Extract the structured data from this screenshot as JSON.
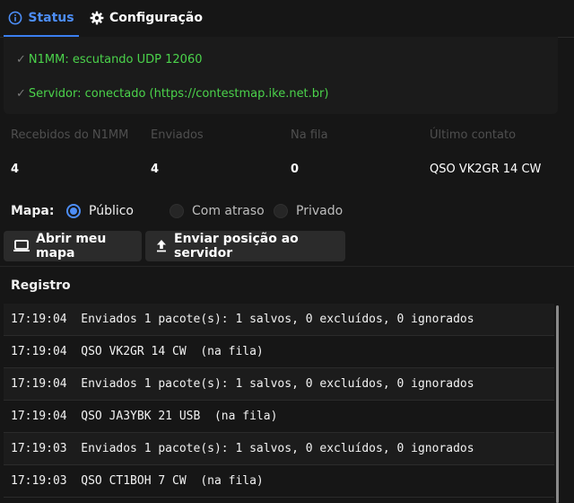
{
  "tabs": [
    {
      "label": "Status",
      "icon": "info-icon",
      "active": true
    },
    {
      "label": "Configuração",
      "icon": "gear-icon",
      "active": false
    }
  ],
  "status": {
    "n1mm": "N1MM: escutando UDP 12060",
    "server": "Servidor: conectado (https://contestmap.ike.net.br)",
    "check_glyph": "✓",
    "color_ok": "#4bd34b"
  },
  "stats": [
    {
      "label": "Recebidos do N1MM",
      "value": "4"
    },
    {
      "label": "Enviados",
      "value": "4"
    },
    {
      "label": "Na fila",
      "value": "0"
    },
    {
      "label": "Último contato",
      "value": "QSO VK2GR 14 CW"
    }
  ],
  "map": {
    "label": "Mapa:",
    "options": [
      {
        "label": "Público",
        "selected": true
      },
      {
        "label": "Com atraso",
        "selected": false
      },
      {
        "label": "Privado",
        "selected": false
      }
    ]
  },
  "buttons": {
    "open_map": {
      "label": "Abrir meu mapa",
      "icon": "laptop-icon"
    },
    "send_position": {
      "label": "Enviar posição ao servidor",
      "icon": "upload-icon"
    }
  },
  "log": {
    "title": "Registro",
    "entries": [
      "17:19:04  Enviados 1 pacote(s): 1 salvos, 0 excluídos, 0 ignorados",
      "17:19:04  QSO VK2GR 14 CW  (na fila)",
      "17:19:04  Enviados 1 pacote(s): 1 salvos, 0 excluídos, 0 ignorados",
      "17:19:04  QSO JA3YBK 21 USB  (na fila)",
      "17:19:03  Enviados 1 pacote(s): 1 salvos, 0 excluídos, 0 ignorados",
      "17:19:03  QSO CT1BOH 7 CW  (na fila)"
    ]
  },
  "colors": {
    "accent": "#4d8ef7",
    "background": "#161616"
  }
}
